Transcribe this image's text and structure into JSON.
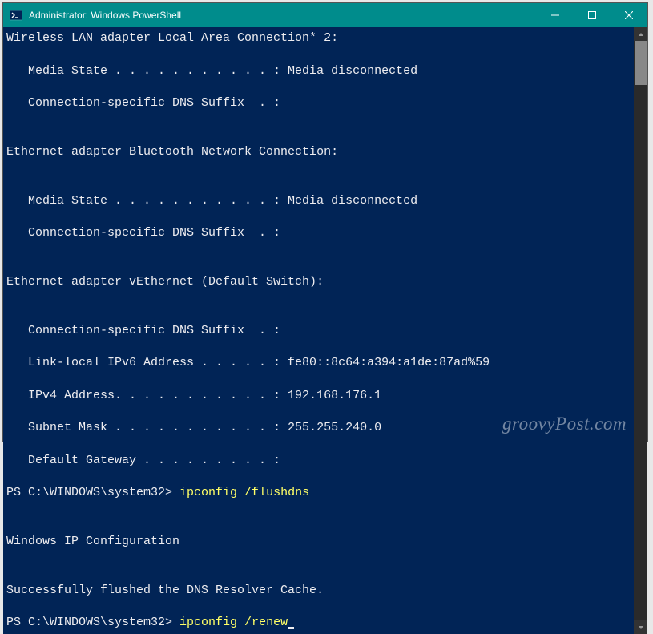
{
  "window": {
    "title": "Administrator: Windows PowerShell"
  },
  "term": {
    "l1": "Wireless LAN adapter Local Area Connection* 2:",
    "l2": "   Media State . . . . . . . . . . . : Media disconnected",
    "l3": "   Connection-specific DNS Suffix  . :",
    "l4": "Ethernet adapter Bluetooth Network Connection:",
    "l5": "   Media State . . . . . . . . . . . : Media disconnected",
    "l6": "   Connection-specific DNS Suffix  . :",
    "l7": "Ethernet adapter vEthernet (Default Switch):",
    "l8": "   Connection-specific DNS Suffix  . :",
    "l9": "   Link-local IPv6 Address . . . . . : fe80::8c64:a394:a1de:87ad%59",
    "l10": "   IPv4 Address. . . . . . . . . . . : 192.168.176.1",
    "l11": "   Subnet Mask . . . . . . . . . . . : 255.255.240.0",
    "l12": "   Default Gateway . . . . . . . . . :",
    "p1prompt": "PS C:\\WINDOWS\\system32> ",
    "p1cmd": "ipconfig /flushdns",
    "l13": "Windows IP Configuration",
    "l14": "Successfully flushed the DNS Resolver Cache.",
    "p2prompt": "PS C:\\WINDOWS\\system32> ",
    "p2cmd": "ipconfig /renew"
  },
  "watermark": "groovyPost.com"
}
